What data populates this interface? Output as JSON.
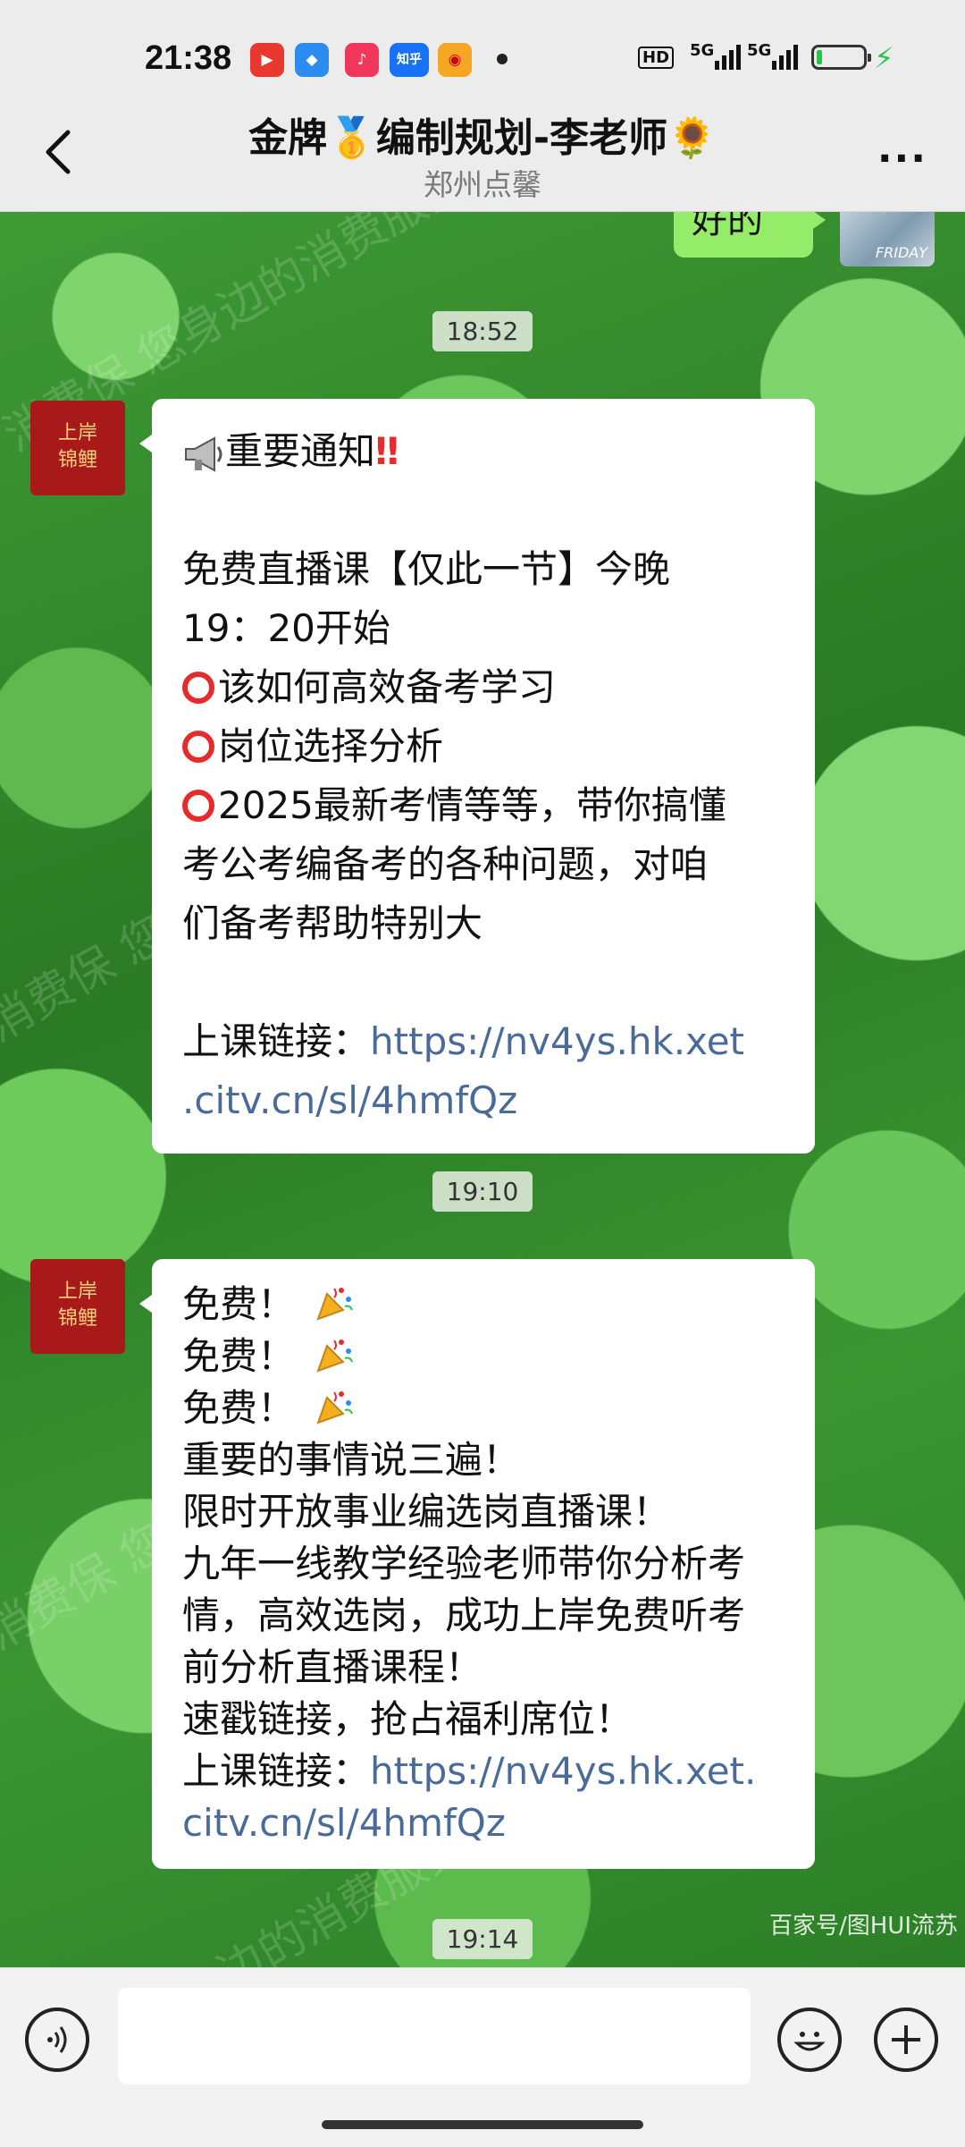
{
  "status_bar": {
    "time": "21:38",
    "notification_apps": [
      "video-app-icon",
      "message-app-icon",
      "music-app-icon",
      "zhihu-app-icon",
      "weibo-app-icon"
    ],
    "zhihu_label": "知乎",
    "hd_label": "HD",
    "network_1": "5G",
    "network_2": "5G",
    "battery_level_percent": 10
  },
  "nav": {
    "title": "金牌🥇编制规划-李老师🌻",
    "subtitle": "郑州点馨",
    "more_label": "···"
  },
  "chat": {
    "sent_message": "好的",
    "sent_avatar_text": "FRIDAY",
    "contact_avatar_line1": "上岸",
    "contact_avatar_line2": "锦鲤",
    "timestamps": [
      "18:52",
      "19:10",
      "19:14"
    ],
    "message1": {
      "l1": "重要通知",
      "l2": "免费直播课【仅此一节】今晚",
      "l3": "19：20开始",
      "l4": "该如何高效备考学习",
      "l5": "岗位选择分析",
      "l6a": "2025最新考情等等，带你搞懂",
      "l6b": "考公考编备考的各种问题，对咱",
      "l6c": "们备考帮助特别大",
      "link_label": "上课链接：",
      "link_a": "https://nv4ys.hk.xet",
      "link_b": ".citv.cn/sl/4hmfQz"
    },
    "message2": {
      "l1": "免费！",
      "l2": "免费！",
      "l3": "免费！",
      "l4": "重要的事情说三遍！",
      "l5": "限时开放事业编选岗直播课！",
      "l6": "九年一线教学经验老师带你分析考",
      "l7": "情，高效选岗，成功上岸免费听考",
      "l8": "前分析直播课程！",
      "l9": "速戳链接，抢占福利席位！",
      "link_label": "上课链接：",
      "link_a": "https://nv4ys.hk.xet.",
      "link_b": "citv.cn/sl/4hmfQz"
    },
    "watermark": "消费保 您身边的消费服务管家",
    "image_credit": "百家号/图HUI流苏"
  },
  "colors": {
    "sent_bubble": "#95ec69",
    "link": "#4a6b9a",
    "accent_red": "#e52b2b"
  }
}
